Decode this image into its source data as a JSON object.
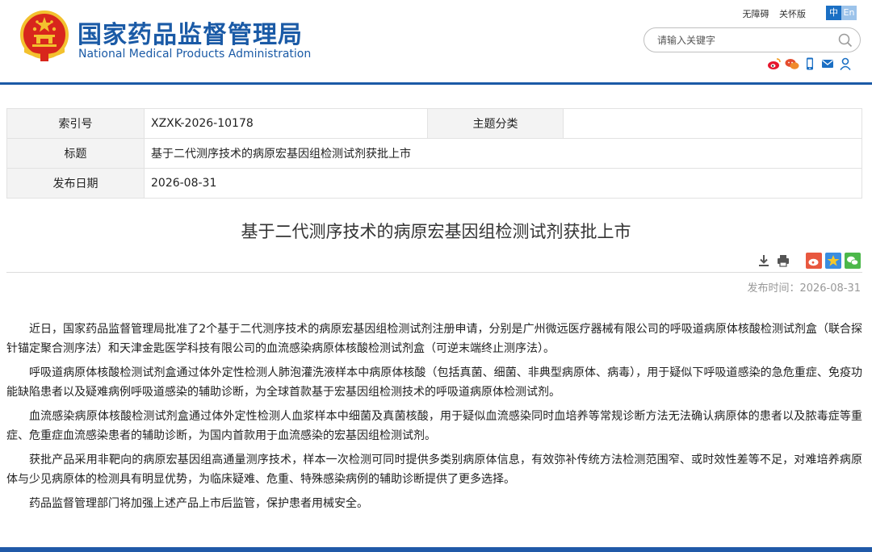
{
  "header": {
    "site_name_cn": "国家药品监督管理局",
    "site_name_en": "National Medical Products Administration",
    "top_links": [
      "无障碍",
      "关怀版"
    ],
    "lang": [
      "中",
      "En"
    ],
    "search_placeholder": "请输入关键字",
    "social_icons": [
      "weibo-icon",
      "wechat-icon",
      "mobile-icon",
      "email-icon",
      "user-icon"
    ]
  },
  "info_table": {
    "index_label": "索引号",
    "index_value": "XZXK-2026-10178",
    "category_label": "主题分类",
    "category_value": "",
    "title_label": "标题",
    "title_value": "基于二代测序技术的病原宏基因组检测试剂获批上市",
    "date_label": "发布日期",
    "date_value": "2026-08-31"
  },
  "article": {
    "title": "基于二代测序技术的病原宏基因组检测试剂获批上市",
    "published": "发布时间：2026-08-31",
    "paragraphs": [
      "近日，国家药品监督管理局批准了2个基于二代测序技术的病原宏基因组检测试剂注册申请，分别是广州微远医疗器械有限公司的呼吸道病原体核酸检测试剂盒（联合探针锚定聚合测序法）和天津金匙医学科技有限公司的血流感染病原体核酸检测试剂盒（可逆末端终止测序法）。",
      "呼吸道病原体核酸检测试剂盒通过体外定性检测人肺泡灌洗液样本中病原体核酸（包括真菌、细菌、非典型病原体、病毒），用于疑似下呼吸道感染的急危重症、免疫功能缺陷患者以及疑难病例呼吸道感染的辅助诊断，为全球首款基于宏基因组检测技术的呼吸道病原体检测试剂。",
      "血流感染病原体核酸检测试剂盒通过体外定性检测人血浆样本中细菌及真菌核酸，用于疑似血流感染同时血培养等常规诊断方法无法确认病原体的患者以及脓毒症等重症、危重症血流感染患者的辅助诊断，为国内首款用于血流感染的宏基因组检测试剂。",
      "获批产品采用非靶向的病原宏基因组高通量测序技术，样本一次检测可同时提供多类别病原体信息，有效弥补传统方法检测范围窄、或时效性差等不足，对难培养病原体与少见病原体的检测具有明显优势，为临床疑难、危重、特殊感染病例的辅助诊断提供了更多选择。",
      "药品监督管理部门将加强上述产品上市后监管，保护患者用械安全。"
    ]
  },
  "tool_icons": [
    "download-icon",
    "print-icon",
    "share-weibo-icon",
    "share-qzone-icon",
    "share-wechat-icon"
  ],
  "colors": {
    "brand": "#1a5aa6",
    "accent": "#1a6fc4"
  }
}
